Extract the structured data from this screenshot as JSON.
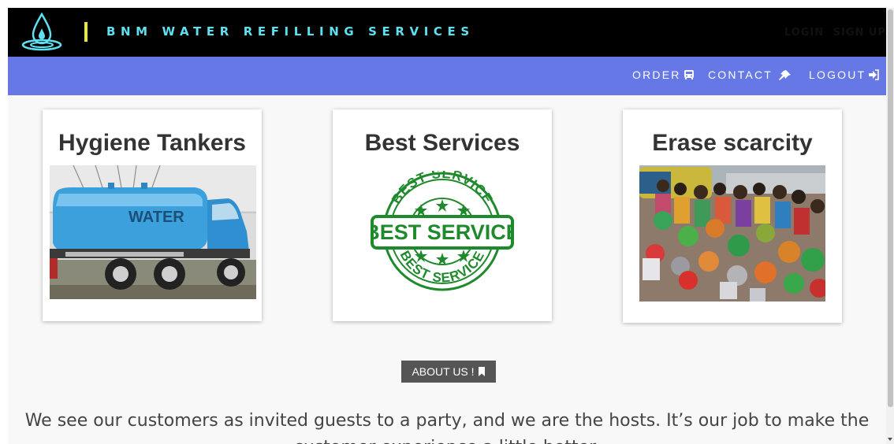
{
  "header": {
    "brand": "BNM WATER REFILLING SERVICES",
    "top_links": [
      "LOGIN",
      "SIGN UP"
    ],
    "logo_icon": "water-drop-logo-icon",
    "accent_color": "#5ee0f0",
    "bar_color": "#e8e83a"
  },
  "nav": {
    "background": "#6578e6",
    "items": [
      {
        "label": "ORDER",
        "icon": "bus-icon"
      },
      {
        "label": "CONTACT",
        "icon": "pin-icon"
      },
      {
        "label": "LOGOUT",
        "icon": "sign-in-icon"
      }
    ]
  },
  "cards": [
    {
      "title": "Hygiene Tankers",
      "image": "water-tanker-truck"
    },
    {
      "title": "Best Services",
      "image": "best-service-stamp"
    },
    {
      "title": "Erase scarcity",
      "image": "crowd-with-water-pots"
    }
  ],
  "stamp": {
    "ring_top": "BEST SERVICE",
    "banner": "BEST SERVICE",
    "ring_bottom": "BEST SERVICE"
  },
  "truck": {
    "label": "WATER"
  },
  "about": {
    "label": "ABOUT US !",
    "icon": "bookmark-icon"
  },
  "tagline": "We see our customers as invited guests to a party, and we are the hosts. It’s our job to make the customer experience a little better."
}
